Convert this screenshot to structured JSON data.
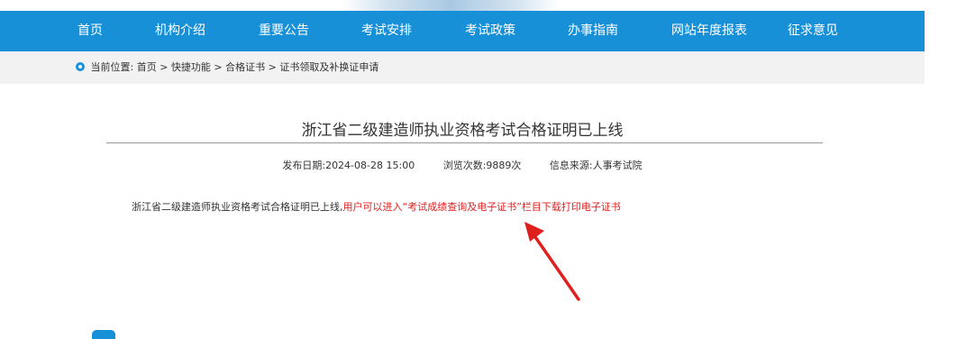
{
  "nav": {
    "items": [
      "首页",
      "机构介绍",
      "重要公告",
      "考试安排",
      "考试政策",
      "办事指南",
      "网站年度报表",
      "征求意见"
    ]
  },
  "breadcrumb": {
    "prefix": "当前位置:",
    "path": "首页 > 快捷功能 > 合格证书 > 证书领取及补换证申请"
  },
  "article": {
    "title": "浙江省二级建造师执业资格考试合格证明已上线",
    "publish_date": "发布日期:2024-08-28 15:00",
    "views": "浏览次数:9889次",
    "source": "信息来源:人事考试院",
    "body_plain": "浙江省二级建造师执业资格考试合格证明已上线,",
    "body_highlight": "用户可以进入“考试成绩查询及电子证书”栏目下载打印电子证书"
  },
  "colors": {
    "nav_bg": "#1790d8",
    "highlight": "#e0201f",
    "arrow": "#e0201f"
  }
}
